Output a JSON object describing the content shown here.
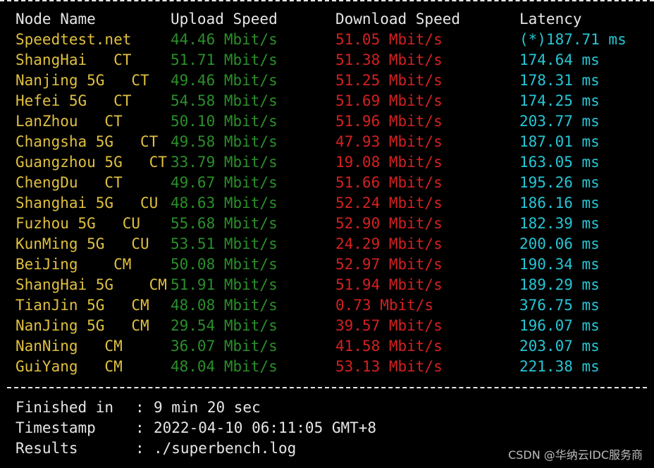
{
  "terminal": {
    "headers": {
      "node": "Node Name",
      "upload": "Upload Speed",
      "download": "Download Speed",
      "latency": "Latency"
    },
    "rows": [
      {
        "node": "Speedtest.net",
        "upload": "44.46 Mbit/s",
        "download": "51.05 Mbit/s",
        "latency": "(*)187.71 ms"
      },
      {
        "node": "ShangHai   CT",
        "upload": "51.71 Mbit/s",
        "download": "51.38 Mbit/s",
        "latency": "174.64 ms"
      },
      {
        "node": "Nanjing 5G   CT",
        "upload": "49.46 Mbit/s",
        "download": "51.25 Mbit/s",
        "latency": "178.31 ms"
      },
      {
        "node": "Hefei 5G   CT",
        "upload": "54.58 Mbit/s",
        "download": "51.69 Mbit/s",
        "latency": "174.25 ms"
      },
      {
        "node": "LanZhou   CT",
        "upload": "50.10 Mbit/s",
        "download": "51.96 Mbit/s",
        "latency": "203.77 ms"
      },
      {
        "node": "Changsha 5G   CT",
        "upload": "49.58 Mbit/s",
        "download": "47.93 Mbit/s",
        "latency": "187.01 ms"
      },
      {
        "node": "Guangzhou 5G   CT",
        "upload": "33.79 Mbit/s",
        "download": "19.08 Mbit/s",
        "latency": "163.05 ms"
      },
      {
        "node": "ChengDu   CT",
        "upload": "49.67 Mbit/s",
        "download": "51.66 Mbit/s",
        "latency": "195.26 ms"
      },
      {
        "node": "Shanghai 5G   CU",
        "upload": "48.63 Mbit/s",
        "download": "52.24 Mbit/s",
        "latency": "186.16 ms"
      },
      {
        "node": "Fuzhou 5G   CU",
        "upload": "55.68 Mbit/s",
        "download": "52.90 Mbit/s",
        "latency": "182.39 ms"
      },
      {
        "node": "KunMing 5G   CU",
        "upload": "53.51 Mbit/s",
        "download": "24.29 Mbit/s",
        "latency": "200.06 ms"
      },
      {
        "node": "BeiJing    CM",
        "upload": "50.08 Mbit/s",
        "download": "52.97 Mbit/s",
        "latency": "190.34 ms"
      },
      {
        "node": "ShangHai 5G    CM",
        "upload": "51.91 Mbit/s",
        "download": "51.94 Mbit/s",
        "latency": "189.29 ms"
      },
      {
        "node": "TianJin 5G   CM",
        "upload": "48.08 Mbit/s",
        "download": "0.73 Mbit/s",
        "latency": "376.75 ms"
      },
      {
        "node": "NanJing 5G   CM",
        "upload": "29.54 Mbit/s",
        "download": "39.57 Mbit/s",
        "latency": "196.07 ms"
      },
      {
        "node": "NanNing   CM",
        "upload": "36.07 Mbit/s",
        "download": "41.58 Mbit/s",
        "latency": "203.07 ms"
      },
      {
        "node": "GuiYang   CM",
        "upload": "48.04 Mbit/s",
        "download": "53.13 Mbit/s",
        "latency": "221.38 ms"
      }
    ],
    "summary": [
      {
        "key": "Finished in",
        "value": "9 min 20 sec"
      },
      {
        "key": "Timestamp",
        "value": "2022-04-10 06:11:05 GMT+8"
      },
      {
        "key": "Results",
        "value": "./superbench.log"
      }
    ],
    "colon": ":"
  },
  "watermark": "CSDN @华纳云IDC服务商",
  "colors": {
    "background": "#000000",
    "node": "#e0c040",
    "upload": "#2a8f2a",
    "download": "#d52020",
    "latency": "#26c6d6",
    "text": "#e6e6e6"
  }
}
